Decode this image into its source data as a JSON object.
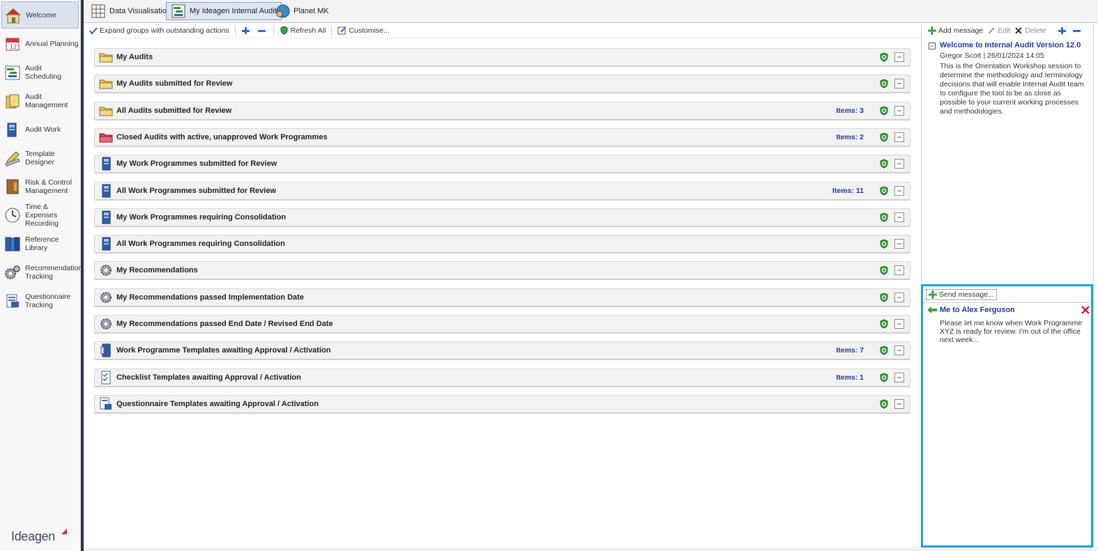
{
  "sidebar": {
    "items": [
      {
        "label": "Welcome",
        "icon": "house-icon"
      },
      {
        "label": "Annual Planning",
        "icon": "calendar-icon"
      },
      {
        "label": "Audit Scheduling",
        "icon": "gantt-chart-icon"
      },
      {
        "label": "Audit Management",
        "icon": "folder-cabinet-icon"
      },
      {
        "label": "Audit Work",
        "icon": "document-stack-icon"
      },
      {
        "label": "Template Designer",
        "icon": "pencil-ruler-icon"
      },
      {
        "label": "Risk & Control Management",
        "icon": "binder-icon"
      },
      {
        "label": "Time & Expenses Recording",
        "icon": "clock-icon"
      },
      {
        "label": "Reference Library",
        "icon": "books-icon"
      },
      {
        "label": "Recommendation Tracking",
        "icon": "gears-icon"
      },
      {
        "label": "Questionnaire Tracking",
        "icon": "questionnaire-icon"
      }
    ],
    "logo": "Ideagen"
  },
  "tabs": [
    {
      "label": "Data Visualisation",
      "icon": "grid-table-icon"
    },
    {
      "label": "My Ideagen Internal Audit",
      "icon": "tasks-icon"
    },
    {
      "label": "Planet MK",
      "icon": "globe-user-icon"
    }
  ],
  "toolbar": {
    "expand_label": "Expand groups with outstanding actions",
    "refresh_label": "Refresh All",
    "customise_label": "Customise..."
  },
  "rows": [
    {
      "label": "My Audits",
      "count": "",
      "icon": "folder-icon"
    },
    {
      "label": "My Audits submitted for Review",
      "count": "",
      "icon": "folder-icon"
    },
    {
      "label": "All Audits submitted for Review",
      "count": "Items: 3",
      "icon": "folder-icon"
    },
    {
      "label": "Closed Audits with active, unapproved Work Programmes",
      "count": "Items: 2",
      "icon": "red-folder-icon"
    },
    {
      "label": "My Work Programmes submitted for Review",
      "count": "",
      "icon": "work-programme-icon"
    },
    {
      "label": "All Work Programmes submitted for Review",
      "count": "Items: 11",
      "icon": "work-programme-icon"
    },
    {
      "label": "My Work Programmes requiring Consolidation",
      "count": "",
      "icon": "work-programme-icon"
    },
    {
      "label": "All Work Programmes requiring Consolidation",
      "count": "",
      "icon": "work-programme-icon"
    },
    {
      "label": "My Recommendations",
      "count": "",
      "icon": "gear-icon"
    },
    {
      "label": "My Recommendations passed Implementation Date",
      "count": "",
      "icon": "gear-icon"
    },
    {
      "label": "My Recommendations passed End Date / Revised End Date",
      "count": "",
      "icon": "gear-icon"
    },
    {
      "label": "Work Programme Templates awaiting Approval / Activation",
      "count": "Items: 7",
      "icon": "template-icon"
    },
    {
      "label": "Checklist Templates awaiting Approval / Activation",
      "count": "Items: 1",
      "icon": "checklist-icon"
    },
    {
      "label": "Questionnaire Templates awaiting Approval / Activation",
      "count": "",
      "icon": "questionnaire-icon"
    }
  ],
  "messages": {
    "add_label": "Add message",
    "edit_label": "Edit",
    "delete_label": "Delete",
    "title": "Welcome to Internal Audit Version 12.0",
    "meta": "Gregor Scott | 26/01/2024 14:05",
    "body": "This is the Orientation Workshop session to determine the methodology and terminology decisions that will enable Internal Audit team to configure the tool to be as close as possible to your current working processes and methodologies."
  },
  "send": {
    "send_label": "Send message...",
    "title": "Me to Alex Ferguson",
    "body": "Please let me know when Work Programme XYZ is ready for review. I'm out of the office next week..."
  },
  "colors": {
    "accent_blue": "#1aa1e0",
    "link_blue": "#1f3a9e",
    "shield_green": "#3aa43a"
  }
}
